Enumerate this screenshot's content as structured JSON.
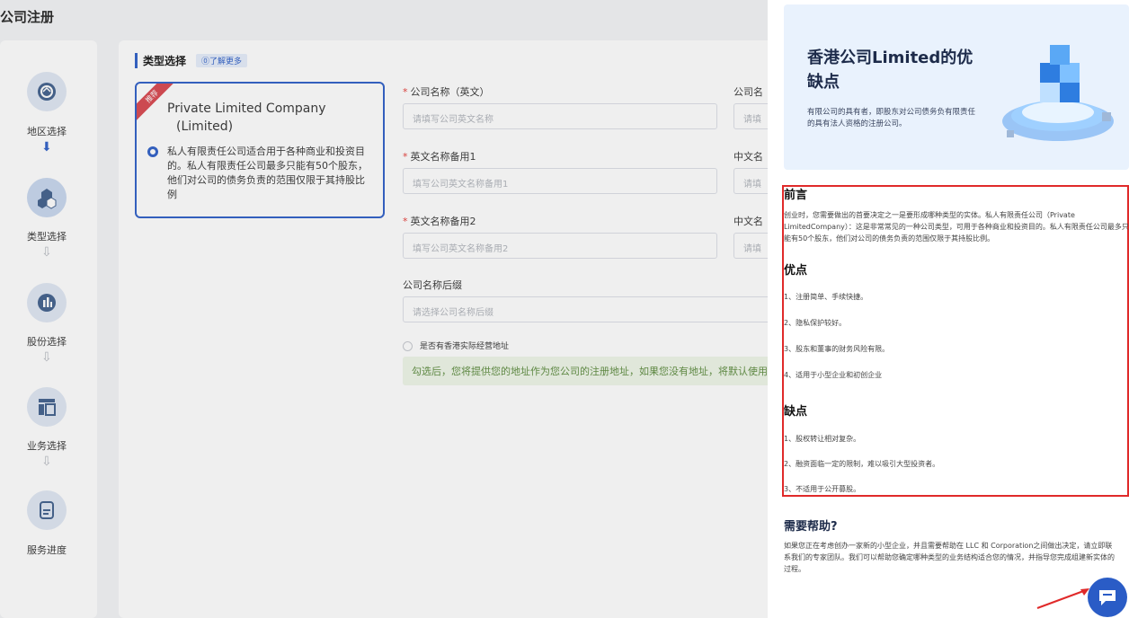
{
  "page": {
    "title": "公司注册"
  },
  "stepper": {
    "steps": [
      {
        "label": "地区选择",
        "icon": "globe-icon"
      },
      {
        "label": "类型选择",
        "icon": "hexagons-icon"
      },
      {
        "label": "股份选择",
        "icon": "bar-chart-icon"
      },
      {
        "label": "业务选择",
        "icon": "layout-icon"
      },
      {
        "label": "服务进度",
        "icon": "document-icon"
      }
    ]
  },
  "type_section": {
    "title": "类型选择",
    "learn_more": "⓪了解更多",
    "card": {
      "badge": "推荐",
      "name_line1": "Private Limited Company",
      "name_line2": "(Limited)",
      "description": "私人有限责任公司适合用于各种商业和投资目的。私人有限责任公司最多只能有50个股东，他们对公司的债务负责的范围仅限于其持股比例"
    }
  },
  "form": {
    "company_name_en": {
      "label": "公司名称（英文）",
      "placeholder": "请填写公司英文名称"
    },
    "company_name_cn": {
      "label": "公司名",
      "placeholder": "请填"
    },
    "alt_name_1": {
      "label": "英文名称备用1",
      "placeholder": "填写公司英文名称备用1"
    },
    "cn_alt_1": {
      "label": "中文名",
      "placeholder": "请填"
    },
    "alt_name_2": {
      "label": "英文名称备用2",
      "placeholder": "填写公司英文名称备用2"
    },
    "cn_alt_2": {
      "label": "中文名",
      "placeholder": "请填"
    },
    "suffix": {
      "label": "公司名称后缀",
      "placeholder": "请选择公司名称后缀"
    },
    "hk_address_checkbox": "是否有香港实际经营地址",
    "hint": "勾选后，您将提供您的地址作为您公司的注册地址，如果您没有地址，将默认使用"
  },
  "drawer": {
    "hero": {
      "title": "香港公司Limited的优缺点",
      "desc": "有限公司的具有者，即股东对公司债务负有限责任的具有法人资格的注册公司。"
    },
    "intro": {
      "heading": "前言",
      "text": "创业时，您需要做出的首要决定之一是要形成哪种类型的实体。私人有限责任公司（Private LimitedCompany）：这是非常常见的一种公司类型，可用于各种商业和投资目的。私人有限责任公司最多只能有50个股东，他们对公司的债务负责的范围仅限于其持股比例。"
    },
    "pros": {
      "heading": "优点",
      "items": [
        "1、注册简单、手续快捷。",
        "2、隐私保护较好。",
        "3、股东和董事的财务风险有限。",
        "4、适用于小型企业和初创企业"
      ]
    },
    "cons": {
      "heading": "缺点",
      "items": [
        "1、股权转让相对复杂。",
        "2、融资面临一定的限制，难以吸引大型投资者。",
        "3、不适用于公开募股。"
      ]
    },
    "help": {
      "heading": "需要帮助?",
      "text": "如果您正在考虑创办一家新的小型企业，并且需要帮助在 LLC 和 Corporation之间做出决定，请立即联系我们的专家团队。我们可以帮助您确定哪种类型的业务结构适合您的情况，并指导您完成组建新实体的过程。"
    }
  },
  "colors": {
    "accent": "#2a5cc6",
    "highlight_border": "#e02a2a"
  }
}
